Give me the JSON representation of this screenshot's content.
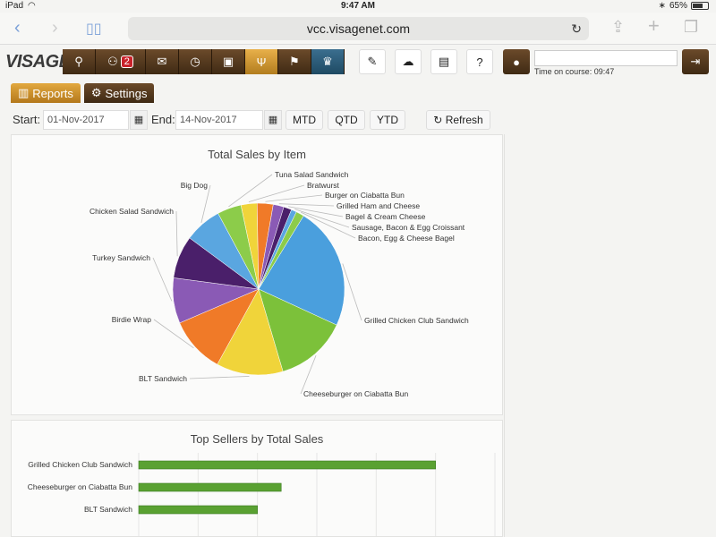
{
  "status_bar": {
    "device": "iPad",
    "time": "9:47 AM",
    "battery": "65%"
  },
  "browser": {
    "url": "vcc.visagenet.com"
  },
  "app": {
    "logo": "VISAGE",
    "message_count": "2",
    "time_on_course_label": "Time on course: 09:47"
  },
  "tabs": {
    "reports": "Reports",
    "settings": "Settings"
  },
  "filters": {
    "start_label": "Start:",
    "start_value": "01-Nov-2017",
    "end_label": "End:",
    "end_value": "14-Nov-2017",
    "mtd": "MTD",
    "qtd": "QTD",
    "ytd": "YTD",
    "refresh": "Refresh"
  },
  "chart_data": [
    {
      "type": "pie",
      "title": "Total Sales by Item",
      "slices": [
        {
          "label": "Grilled Chicken Club Sandwich",
          "value": 23,
          "color": "#4a9fdd"
        },
        {
          "label": "Cheeseburger on Ciabatta Bun",
          "value": 13.5,
          "color": "#7cc13a"
        },
        {
          "label": "BLT Sandwich",
          "value": 12.5,
          "color": "#f0d43a"
        },
        {
          "label": "Birdie Wrap",
          "value": 10.5,
          "color": "#f07a28"
        },
        {
          "label": "Turkey Sandwich",
          "value": 8.5,
          "color": "#8a5ab5"
        },
        {
          "label": "Chicken Salad Sandwich",
          "value": 8,
          "color": "#4a1f6a"
        },
        {
          "label": "Big Dog",
          "value": 7,
          "color": "#5aa6e0"
        },
        {
          "label": "Tuna Salad Sandwich",
          "value": 4.5,
          "color": "#8ccc4a"
        },
        {
          "label": "Bratwurst",
          "value": 3,
          "color": "#f0d43a"
        },
        {
          "label": "Burger on Ciabatta Bun",
          "value": 3,
          "color": "#f07a28"
        },
        {
          "label": "Grilled Ham and Cheese",
          "value": 2,
          "color": "#8a5ab5"
        },
        {
          "label": "Bagel & Cream Cheese",
          "value": 1.5,
          "color": "#4a1f6a"
        },
        {
          "label": "Sausage, Bacon & Egg Croissant",
          "value": 1,
          "color": "#5aa6e0"
        },
        {
          "label": "Bacon, Egg & Cheese Bagel",
          "value": 1.5,
          "color": "#8ccc4a"
        }
      ]
    },
    {
      "type": "bar",
      "orientation": "horizontal",
      "title": "Top Sellers by Total Sales",
      "categories": [
        "Grilled Chicken Club Sandwich",
        "Cheeseburger on Ciabatta Bun",
        "BLT Sandwich"
      ],
      "values": [
        100,
        48,
        40
      ],
      "xlim": [
        0,
        120
      ],
      "grid": true,
      "color": "#5aa132"
    }
  ]
}
